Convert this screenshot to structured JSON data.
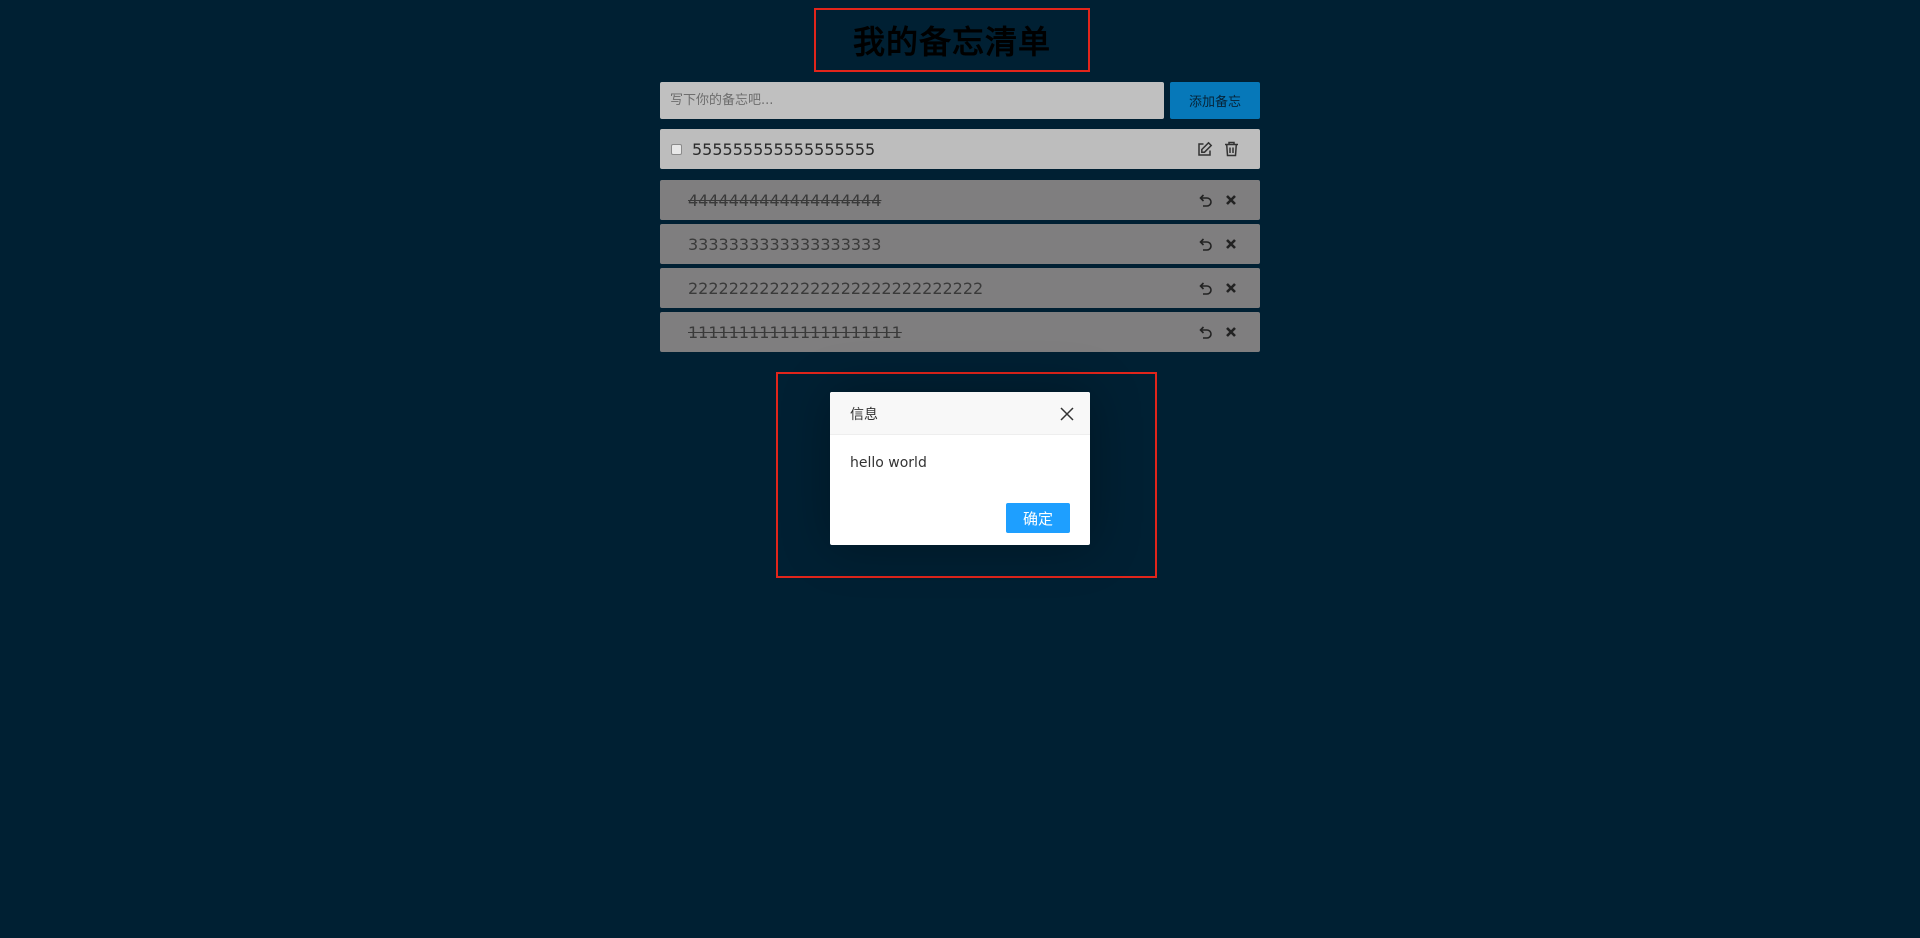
{
  "header": {
    "title": "我的备忘清单"
  },
  "input": {
    "placeholder": "写下你的备忘吧...",
    "value": "",
    "add_label": "添加备忘"
  },
  "active_items": [
    {
      "text": "555555555555555555",
      "checked": false
    }
  ],
  "done_items": [
    {
      "text": "4444444444444444444",
      "strikethrough": true
    },
    {
      "text": "3333333333333333333",
      "strikethrough": false
    },
    {
      "text": "22222222222222222222222222222",
      "strikethrough": false
    },
    {
      "text": "111111111111111111111",
      "strikethrough": true
    }
  ],
  "dialog": {
    "title": "信息",
    "message": "hello world",
    "ok_label": "确定"
  },
  "colors": {
    "background": "#002033",
    "highlight_border": "#e1251b",
    "add_button": "#0678b9",
    "ok_button": "#1e9fff"
  },
  "icons": {
    "active_actions": [
      "edit-icon",
      "trash-icon"
    ],
    "done_actions": [
      "undo-icon",
      "delete-x-icon"
    ],
    "dialog_close": "close-icon"
  }
}
